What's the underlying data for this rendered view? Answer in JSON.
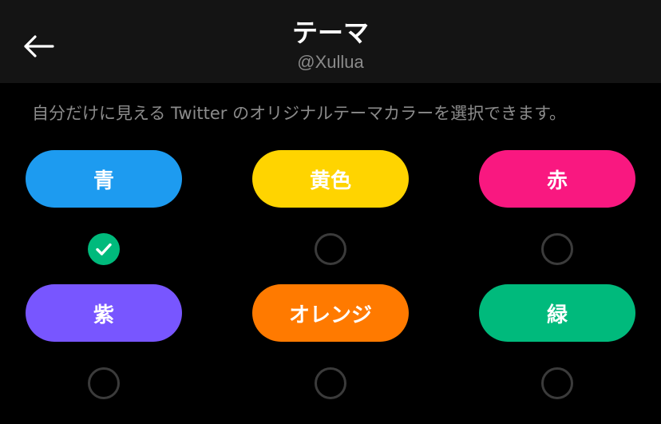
{
  "header": {
    "title": "テーマ",
    "handle": "@Xullua",
    "back_icon": "arrow-left-icon"
  },
  "description": "自分だけに見える Twitter のオリジナルテーマカラーを選択できます。",
  "themes": [
    {
      "label": "青",
      "color": "#1d9bf0",
      "selected": true
    },
    {
      "label": "黄色",
      "color": "#ffd400",
      "selected": false
    },
    {
      "label": "赤",
      "color": "#f91880",
      "selected": false
    },
    {
      "label": "紫",
      "color": "#7856ff",
      "selected": false
    },
    {
      "label": "オレンジ",
      "color": "#ff7a00",
      "selected": false
    },
    {
      "label": "緑",
      "color": "#00ba7c",
      "selected": false
    }
  ],
  "check_icon": "check-icon",
  "selected_check_color": "#00ba7c"
}
